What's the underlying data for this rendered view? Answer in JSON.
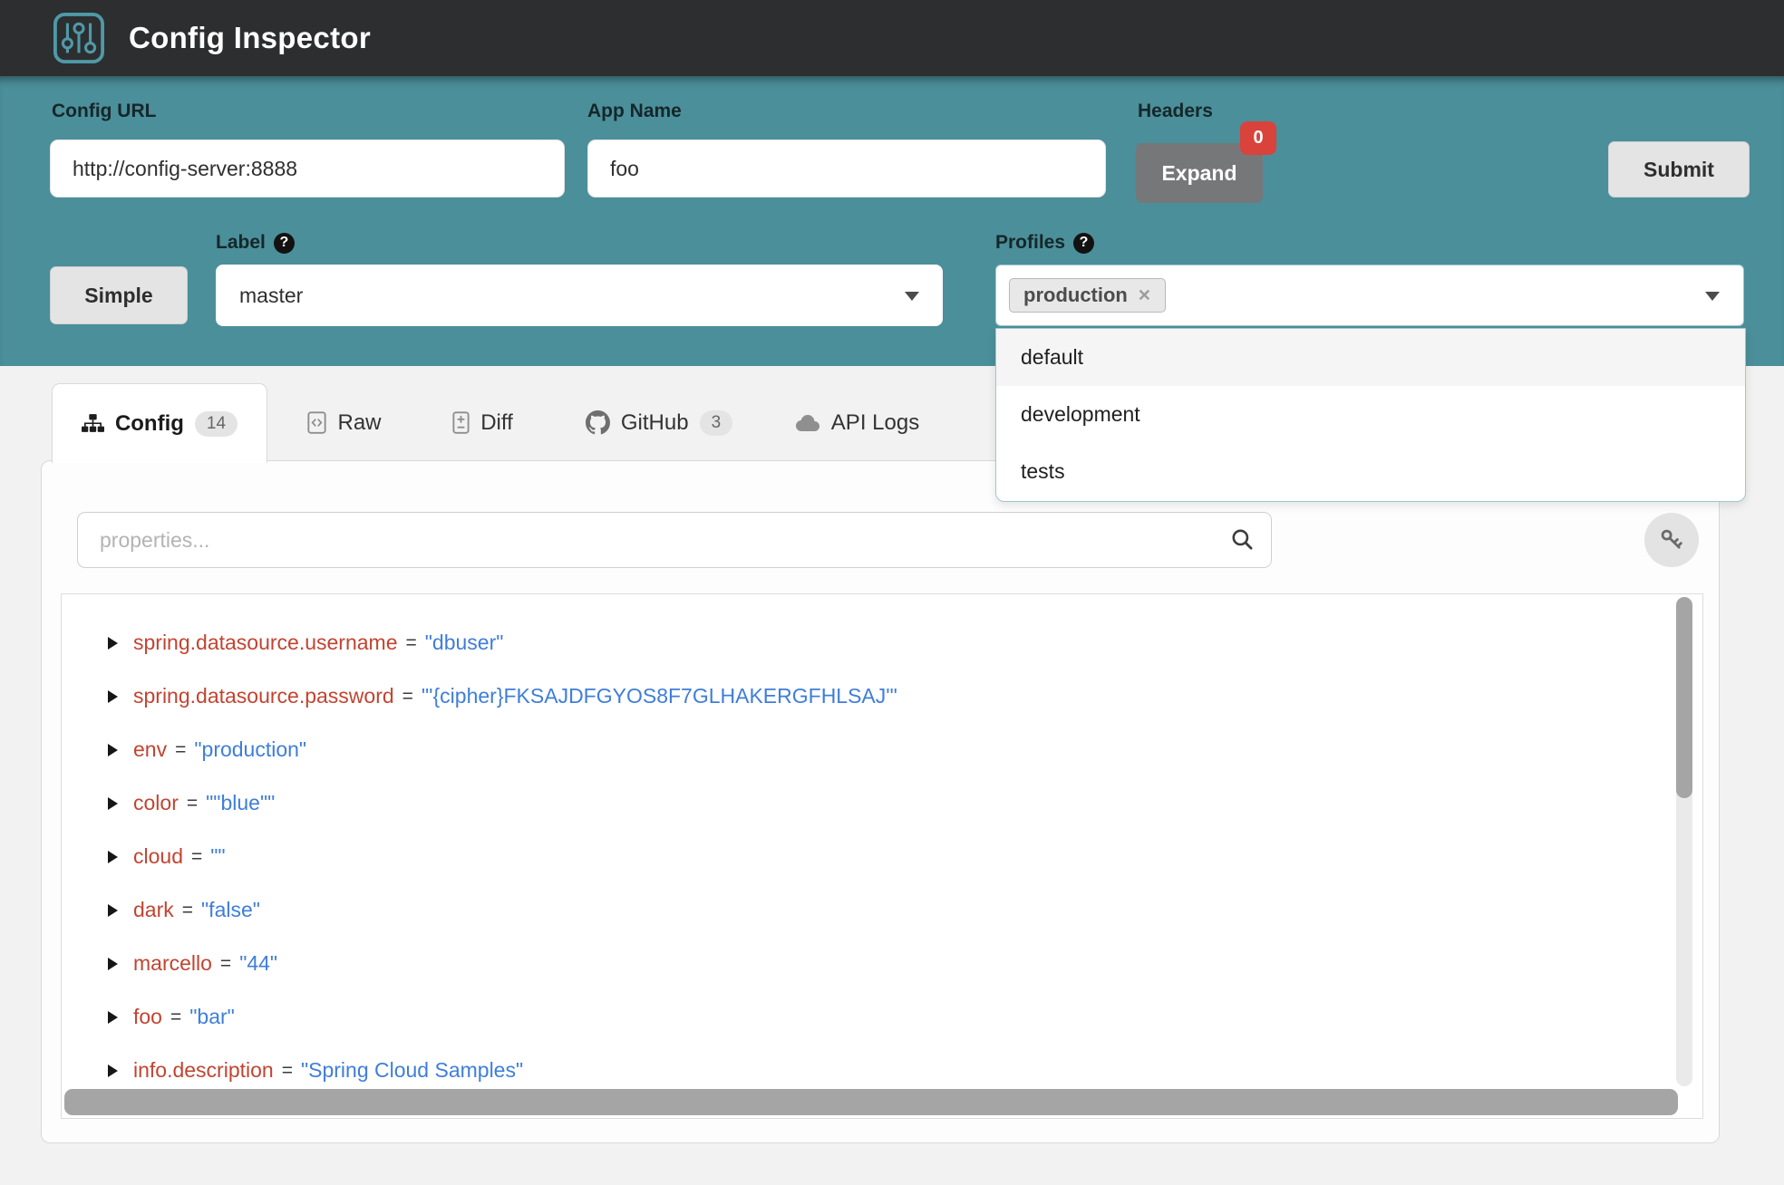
{
  "header": {
    "title": "Config Inspector"
  },
  "toolbar": {
    "config_url_label": "Config URL",
    "config_url_value": "http://config-server:8888",
    "app_name_label": "App Name",
    "app_name_value": "foo",
    "headers_label": "Headers",
    "headers_badge": "0",
    "expand_label": "Expand",
    "submit_label": "Submit",
    "simple_label": "Simple",
    "label_label": "Label",
    "label_value": "master",
    "profiles_label": "Profiles",
    "profiles_selected": "production",
    "profiles_options": [
      "default",
      "development",
      "tests"
    ]
  },
  "tabs": [
    {
      "label": "Config",
      "badge": "14"
    },
    {
      "label": "Raw"
    },
    {
      "label": "Diff"
    },
    {
      "label": "GitHub",
      "badge": "3"
    },
    {
      "label": "API Logs"
    }
  ],
  "search": {
    "placeholder": "properties..."
  },
  "equals": "=",
  "properties": [
    {
      "key": "spring.datasource.username",
      "value": "\"dbuser\""
    },
    {
      "key": "spring.datasource.password",
      "value": "\"'{cipher}FKSAJDFGYOS8F7GLHAKERGFHLSAJ'\""
    },
    {
      "key": "env",
      "value": "\"production\""
    },
    {
      "key": "color",
      "value": "\"\"blue\"\""
    },
    {
      "key": "cloud",
      "value": "\"\""
    },
    {
      "key": "dark",
      "value": "\"false\""
    },
    {
      "key": "marcello",
      "value": "\"44\""
    },
    {
      "key": "foo",
      "value": "\"bar\""
    },
    {
      "key": "info.description",
      "value": "\"Spring Cloud Samples\""
    }
  ],
  "icons": {
    "help_glyph": "?",
    "remove_glyph": "✕",
    "logo": "sliders-icon",
    "config_tab": "sitemap-icon",
    "raw_tab": "file-code-icon",
    "diff_tab": "file-diff-icon",
    "github_tab": "github-icon",
    "api_logs_tab": "cloud-icon",
    "search": "magnifier-icon",
    "key": "key-icon"
  },
  "colors": {
    "header_bg": "#2c2e30",
    "accent_teal": "#4b8f9a",
    "badge_red": "#d9433c",
    "key_red": "#c24431",
    "value_blue": "#3f7ed9"
  }
}
